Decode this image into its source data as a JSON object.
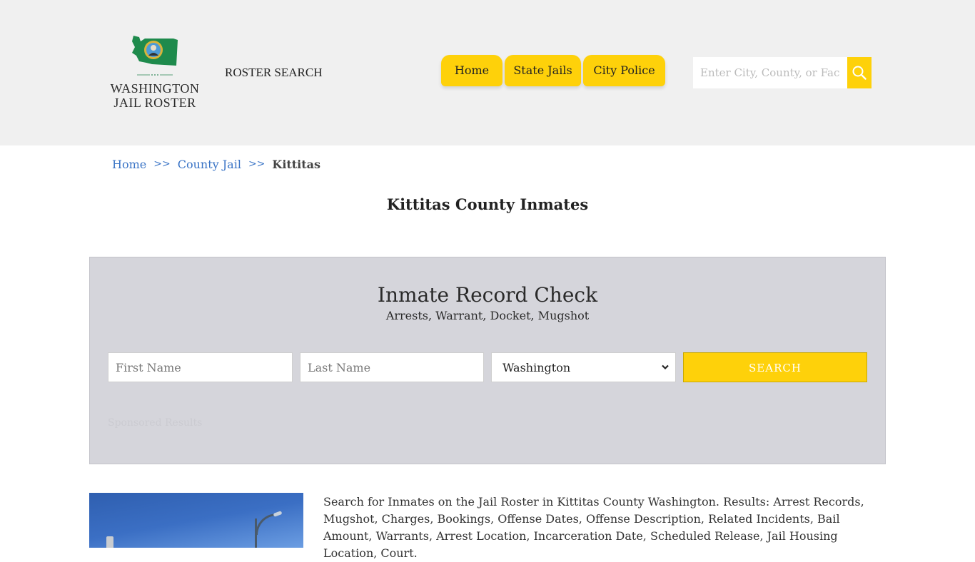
{
  "header": {
    "logo": {
      "line1": "WASHINGTON",
      "line2": "JAIL ROSTER",
      "map_color": "#1e8a4c",
      "icon": "washington-state-seal-icon"
    },
    "roster_search_label": "ROSTER SEARCH",
    "nav": [
      {
        "label": "Home"
      },
      {
        "label": "State Jails"
      },
      {
        "label": "City Police"
      }
    ],
    "search": {
      "placeholder": "Enter City, County, or Facility",
      "icon": "search-icon"
    },
    "accent_color": "#fed10a"
  },
  "breadcrumb": {
    "items": [
      {
        "label": "Home"
      },
      {
        "label": "County Jail"
      }
    ],
    "separator": ">>",
    "current": "Kittitas"
  },
  "page_title": "Kittitas County Inmates",
  "record_check": {
    "title": "Inmate Record Check",
    "subtitle": "Arrests, Warrant, Docket, Mugshot",
    "first_name_placeholder": "First Name",
    "last_name_placeholder": "Last Name",
    "state_selected": "Washington",
    "search_label": "SEARCH",
    "sponsored_label": "Sponsored Results"
  },
  "description": "Search for Inmates on the Jail Roster in Kittitas County Washington. Results: Arrest Records, Mugshot, Charges, Bookings, Offense Dates, Offense Description, Related Incidents, Bail Amount, Warrants, Arrest Location, Incarceration Date, Scheduled Release, Jail Housing Location, Court."
}
